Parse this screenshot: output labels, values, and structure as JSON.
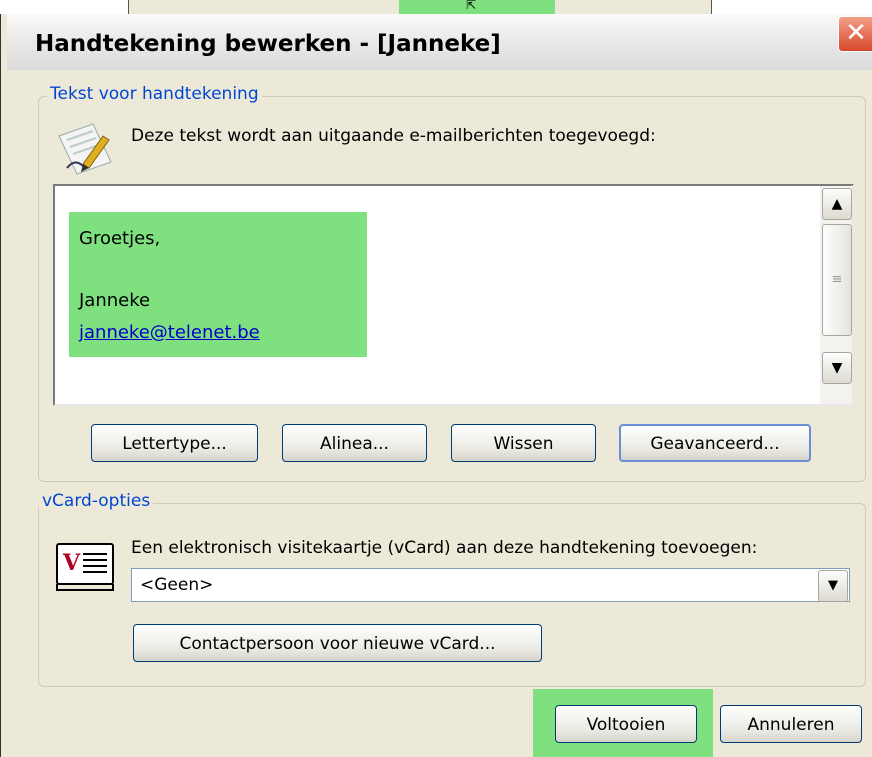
{
  "window": {
    "title": "Handtekening bewerken - [Janneke]",
    "close_glyph": "✕"
  },
  "text_group": {
    "legend": "Tekst voor handtekening",
    "description": "Deze tekst wordt aan uitgaande e-mailberichten toegevoegd:",
    "icon": "pen-paper-icon"
  },
  "signature": {
    "line1": "Groetjes,",
    "line2": "Janneke",
    "email": "janneke@telenet.be"
  },
  "buttons": {
    "font": "Lettertype...",
    "paragraph": "Alinea...",
    "clear": "Wissen",
    "advanced": "Geavanceerd..."
  },
  "vcard_group": {
    "legend": "vCard-opties",
    "description": "Een elektronisch visitekaartje (vCard) aan deze handtekening toevoegen:",
    "selected": "<Geen>",
    "new_contact": "Contactpersoon voor nieuwe vCard...",
    "icon": "vcard-icon"
  },
  "footer": {
    "finish": "Voltooien",
    "cancel": "Annuleren"
  },
  "colors": {
    "highlight": "#7fe07f",
    "legend_text": "#0046d5",
    "close_button": "#d8482c"
  }
}
